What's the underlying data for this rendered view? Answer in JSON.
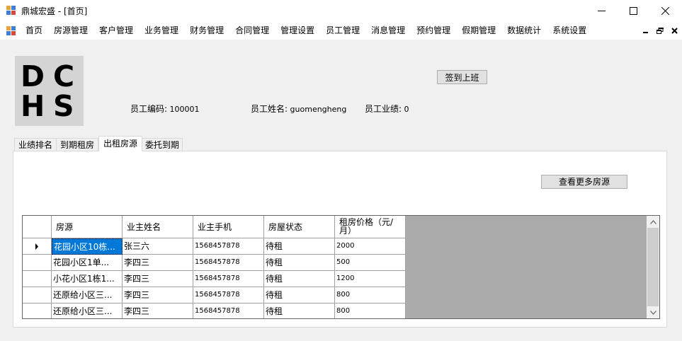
{
  "window": {
    "title": "鼎城宏盛 - [首页]"
  },
  "menu": {
    "items": [
      "首页",
      "房源管理",
      "客户管理",
      "业务管理",
      "财务管理",
      "合同管理",
      "管理设置",
      "员工管理",
      "消息管理",
      "预约管理",
      "假期管理",
      "数据统计",
      "系统设置"
    ]
  },
  "logo": {
    "letters": [
      "D",
      "C",
      "H",
      "S"
    ]
  },
  "header": {
    "sign_in_label": "签到上班",
    "employee_code_label": "员工编码:",
    "employee_code": "100001",
    "employee_name_label": "员工姓名:",
    "employee_name": "guomengheng",
    "employee_perf_label": "员工业绩:",
    "employee_perf": "0"
  },
  "tabs": [
    {
      "label": "业绩排名",
      "active": false
    },
    {
      "label": "到期租房",
      "active": false
    },
    {
      "label": "出租房源",
      "active": true
    },
    {
      "label": "委托到期",
      "active": false
    }
  ],
  "panel": {
    "more_button_label": "查看更多房源"
  },
  "grid": {
    "columns": [
      "房源",
      "业主姓名",
      "业主手机",
      "房屋状态",
      "租房价格（元/月）"
    ],
    "rows": [
      [
        "花园小区10栋...",
        "张三六",
        "1568457878",
        "待租",
        "2000"
      ],
      [
        "花园小区1单...",
        "李四三",
        "1568457878",
        "待租",
        "500"
      ],
      [
        "小花小区1栋1...",
        "李四三",
        "1568457878",
        "待租",
        "1200"
      ],
      [
        "还原给小区三...",
        "李四三",
        "1568457878",
        "待租",
        "800"
      ],
      [
        "还原给小区三...",
        "李四三",
        "1568457878",
        "待租",
        "800"
      ]
    ]
  },
  "colors": {
    "selection": "#0078d7",
    "grid_background": "#ababab"
  }
}
